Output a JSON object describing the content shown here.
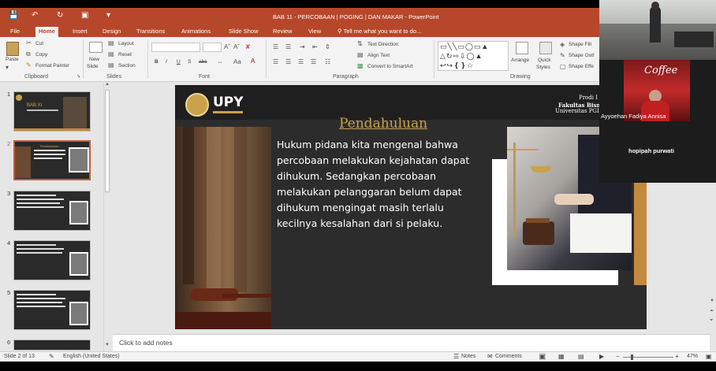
{
  "titlebar": {
    "title": "BAB 11 - PERCOBAAN | POGING | DAN MAKAR - PowerPoint"
  },
  "tabs": [
    "File",
    "Home",
    "Insert",
    "Design",
    "Transitions",
    "Animations",
    "Slide Show",
    "Review",
    "View"
  ],
  "active_tab": "Home",
  "tell_me": "Tell me what you want to do...",
  "ribbon": {
    "clipboard": {
      "paste": "Paste",
      "cut": "Cut",
      "copy": "Copy",
      "format_painter": "Format Painter",
      "label": "Clipboard"
    },
    "slides": {
      "new_slide": "New",
      "new_slide2": "Slide",
      "layout": "Layout",
      "reset": "Reset",
      "section": "Section",
      "label": "Slides"
    },
    "font": {
      "label": "Font",
      "bold": "B",
      "italic": "I",
      "underline": "U",
      "strike": "S",
      "abc": "abc"
    },
    "paragraph": {
      "text_direction": "Text Direction",
      "align_text": "Align Text",
      "smartart": "Convert to SmartArt",
      "label": "Paragraph"
    },
    "drawing": {
      "arrange": "Arrange",
      "quick_styles": "Quick",
      "quick_styles2": "Styles",
      "shape_fill": "Shape Fill",
      "shape_outline": "Shape Outl",
      "shape_effects": "Shape Effe",
      "label": "Drawing"
    }
  },
  "thumbnails": [
    {
      "number": "1",
      "title": "BAB XI"
    },
    {
      "number": "2",
      "title": "Pendahuluan"
    },
    {
      "number": "3",
      "title": ""
    },
    {
      "number": "4",
      "title": ""
    },
    {
      "number": "5",
      "title": ""
    },
    {
      "number": "6",
      "title": ""
    }
  ],
  "slide": {
    "logo": "UPY",
    "header_line1": "Prodi I",
    "header_line2": "Fakultas Bisni",
    "header_line3": "Universitas PGI",
    "title": "Pendahuluan",
    "body": " Hukum pidana kita mengenal bahwa percobaan melakukan kejahatan dapat dihukum. Sedangkan percobaan melakukan pelanggaran belum dapat dihukum mengingat masih terlalu kecilnya kesalahan dari si pelaku."
  },
  "notes_placeholder": "Click to add notes",
  "status": {
    "slide_of": "Slide 2 of 13",
    "language": "English (United States)",
    "notes": "Notes",
    "comments": "Comments",
    "zoom": "47%"
  },
  "video": {
    "participant1": "Ayyoehan Fadiya Annisa",
    "participant2": "hopipah purwati",
    "sign": "Coffee"
  },
  "colors": {
    "accent": "#b7472a",
    "slide_bg": "#2c2c2c",
    "title_gold": "#c9a24a",
    "frame_gold": "#c48a3c"
  }
}
